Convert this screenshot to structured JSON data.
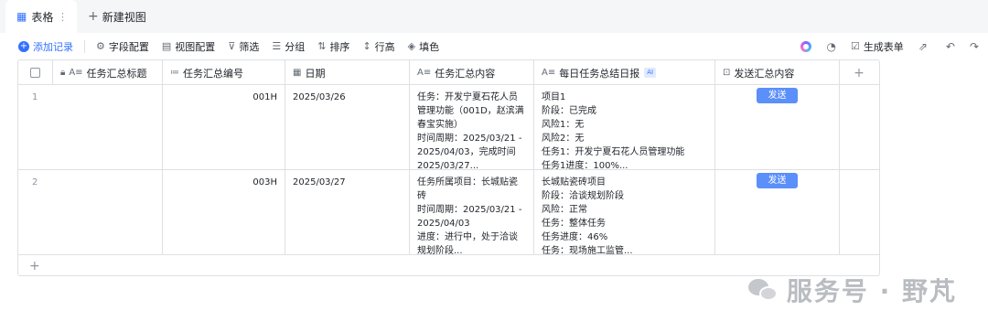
{
  "tabs": {
    "active": {
      "icon": "table-icon",
      "label": "表格"
    },
    "new_view": "新建视图"
  },
  "toolbar": {
    "add_record": "添加记录",
    "field_config": "字段配置",
    "view_config": "视图配置",
    "filter": "筛选",
    "group": "分组",
    "sort": "排序",
    "row_height": "行高",
    "fill_color": "填色",
    "generate_form": "生成表单"
  },
  "columns": [
    {
      "label": "任务汇总标题",
      "icon": "text-icon"
    },
    {
      "label": "任务汇总编号",
      "icon": "number-icon"
    },
    {
      "label": "日期",
      "icon": "date-icon"
    },
    {
      "label": "任务汇总内容",
      "icon": "text-icon"
    },
    {
      "label": "每日任务总结日报",
      "icon": "text-icon",
      "badge": "AI"
    },
    {
      "label": "发送汇总内容",
      "icon": "button-field-icon"
    }
  ],
  "rows": [
    {
      "index": "1",
      "title": "",
      "code": "001H",
      "date": "2025/03/26",
      "content": "任务：开发宁夏石花人员管理功能（001D，赵滨满春宝实施）\n时间周期：2025/03/21 - 2025/04/03，完成时间2025/03/27...",
      "report": "项目1\n阶段：已完成\n风险1：无\n风险2：无\n任务1：开发宁夏石花人员管理功能\n任务1进度：100%...",
      "send_label": "发送"
    },
    {
      "index": "2",
      "title": "",
      "code": "003H",
      "date": "2025/03/27",
      "content": "任务所属项目：长城贴瓷砖\n时间周期：2025/03/21 - 2025/04/03\n进度：进行中，处于洽谈规划阶段...",
      "report": "长城贴瓷砖项目\n阶段：洽谈规划阶段\n风险：正常\n任务：整体任务\n任务进度：46%\n任务：现场施工监管...",
      "send_label": "发送"
    }
  ],
  "watermark": "服务号 · 野芃"
}
